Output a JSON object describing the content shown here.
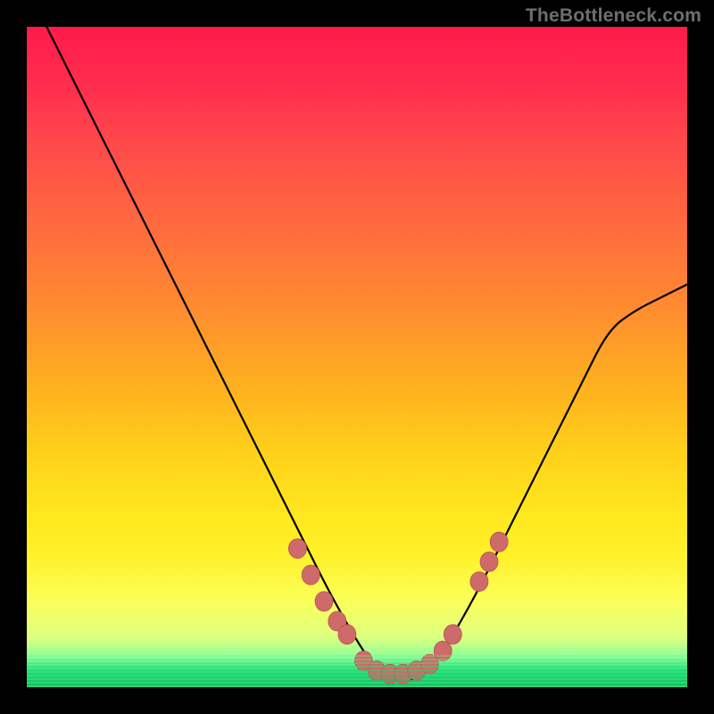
{
  "watermark": "TheBottleneck.com",
  "colors": {
    "curve": "#000000",
    "marker_fill": "#cf6a6a",
    "marker_stroke": "#b85454",
    "gradient_top": "#ff1a4a",
    "gradient_bottom": "#1fd874"
  },
  "chart_data": {
    "type": "line",
    "title": "",
    "xlabel": "",
    "ylabel": "",
    "xlim": [
      0,
      100
    ],
    "ylim": [
      0,
      100
    ],
    "series": [
      {
        "name": "bottleneck-curve",
        "x": [
          2,
          6,
          10,
          14,
          18,
          22,
          26,
          30,
          34,
          38,
          42,
          46,
          50,
          52,
          54,
          56,
          58,
          60,
          62,
          64,
          68,
          72,
          76,
          80,
          84,
          88,
          92,
          96,
          100
        ],
        "y": [
          102,
          94,
          86,
          78,
          70,
          62,
          54,
          46,
          38,
          30,
          22,
          14,
          7,
          4,
          2,
          1,
          1,
          2,
          4,
          7,
          14,
          22,
          30,
          38,
          46,
          54,
          57,
          59,
          61
        ]
      }
    ],
    "markers": {
      "name": "highlight-points",
      "x": [
        41,
        43,
        45,
        47,
        48.5,
        51,
        53,
        55,
        57,
        59,
        61,
        63,
        64.5,
        68.5,
        70,
        71.5
      ],
      "y": [
        21,
        17,
        13,
        10,
        8,
        4,
        2.5,
        2,
        2,
        2.5,
        3.5,
        5.5,
        8,
        16,
        19,
        22
      ]
    }
  }
}
